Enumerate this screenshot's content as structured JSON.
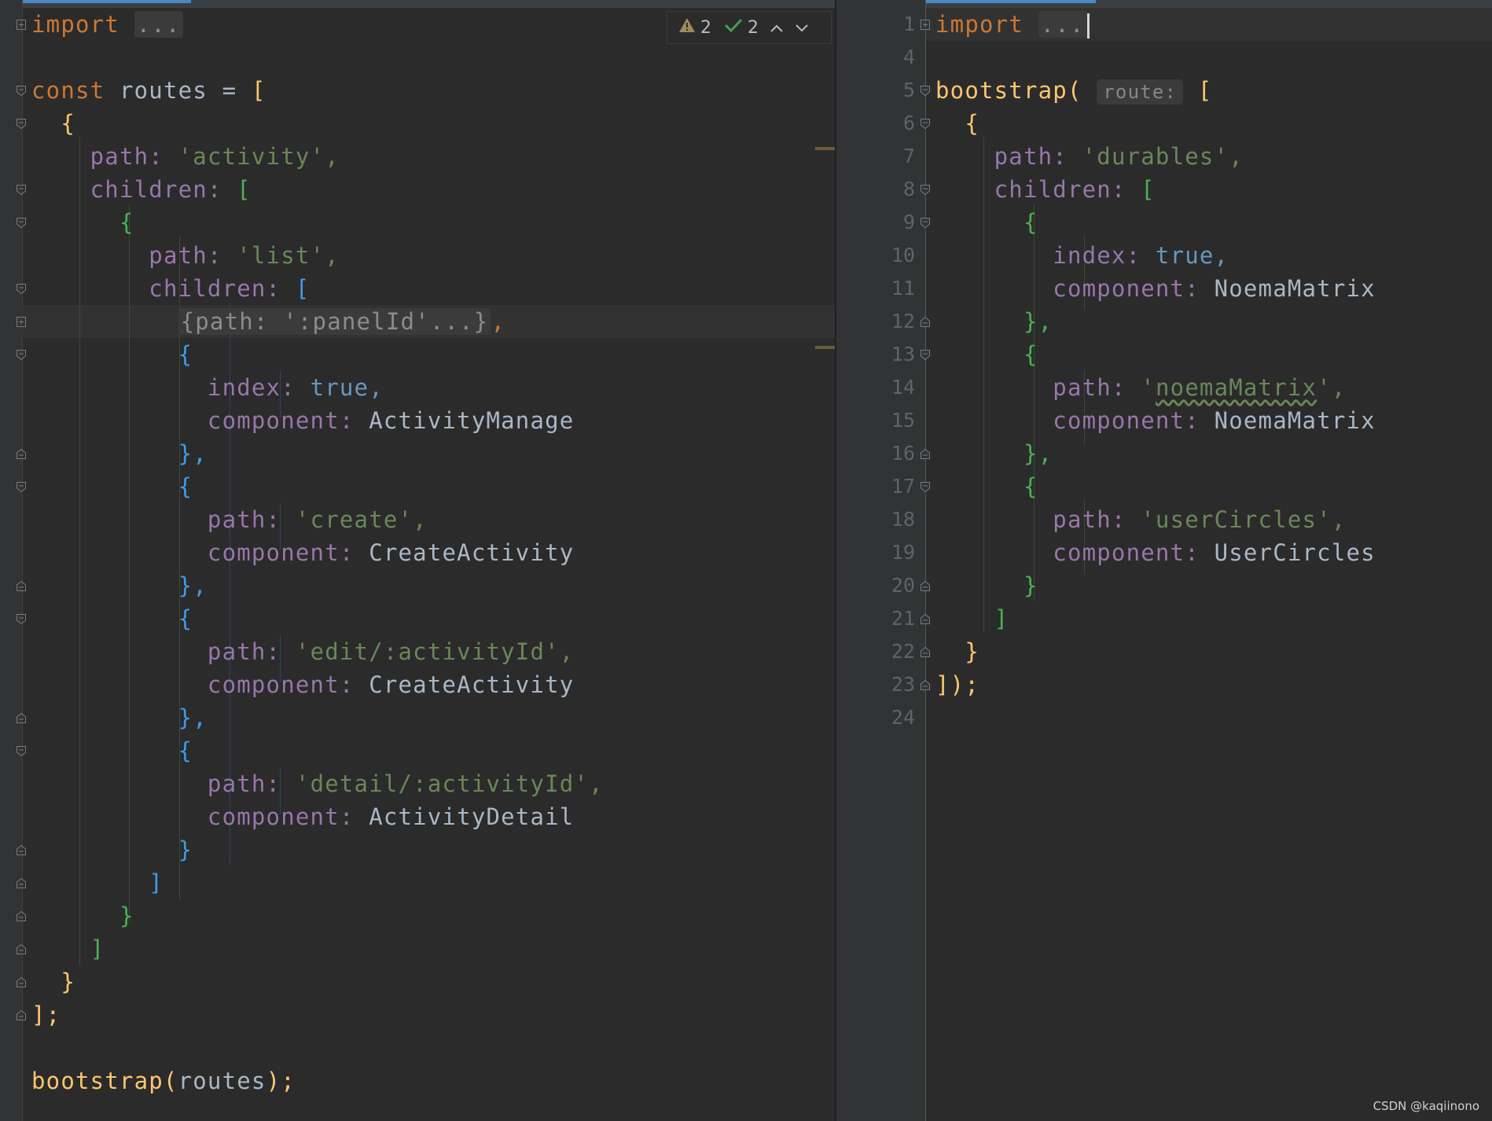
{
  "left_editor": {
    "inspection": {
      "warnings": "2",
      "checks": "2"
    },
    "lines": [
      "import",
      "...",
      "const",
      "routes",
      "=",
      "[",
      "{",
      "path:",
      "'activity',",
      "children:",
      "[",
      "{",
      "path:",
      "'list',",
      "children:",
      "[",
      "{path: ':panelId'...}",
      ",",
      "{",
      "index:",
      "true,",
      "component:",
      "ActivityManage",
      "},",
      "{",
      "path:",
      "'create',",
      "component:",
      "CreateActivity",
      "},",
      "{",
      "path:",
      "'edit/:activityId',",
      "component:",
      "CreateActivity",
      "},",
      "{",
      "path:",
      "'detail/:activityId',",
      "component:",
      "ActivityDetail",
      "}",
      "]",
      "}",
      "]",
      "}",
      "];",
      "bootstrap(",
      "routes",
      ");"
    ]
  },
  "right_editor": {
    "line_numbers": [
      "1",
      "4",
      "5",
      "6",
      "7",
      "8",
      "9",
      "10",
      "11",
      "12",
      "13",
      "14",
      "15",
      "16",
      "17",
      "18",
      "19",
      "20",
      "21",
      "22",
      "23",
      "24"
    ],
    "parameter_hint": "route:",
    "tokens": [
      "import",
      "...",
      "bootstrap(",
      "[",
      "{",
      "path:",
      "'durables',",
      "children:",
      "[",
      "{",
      "index:",
      "true,",
      "component:",
      "NoemaMatrix",
      "},",
      "{",
      "path:",
      "'",
      "noemaMatrix",
      "',",
      "component:",
      "NoemaMatrix",
      "},",
      "{",
      "path:",
      "'userCircles',",
      "component:",
      "UserCircles",
      "}",
      "]",
      "}",
      "]);"
    ]
  },
  "watermark": "CSDN @kaqiinono",
  "colors": {
    "background": "#2b2b2b",
    "gutter": "#313335",
    "keyword": "#cc7832",
    "function": "#ffc66d",
    "property": "#9876aa",
    "string": "#6a8759",
    "boolean": "#6897bb",
    "identifier": "#a9b7c6"
  },
  "icons": [
    "warning-icon",
    "check-icon",
    "chevron-up-icon",
    "chevron-down-icon",
    "fold-icon"
  ]
}
